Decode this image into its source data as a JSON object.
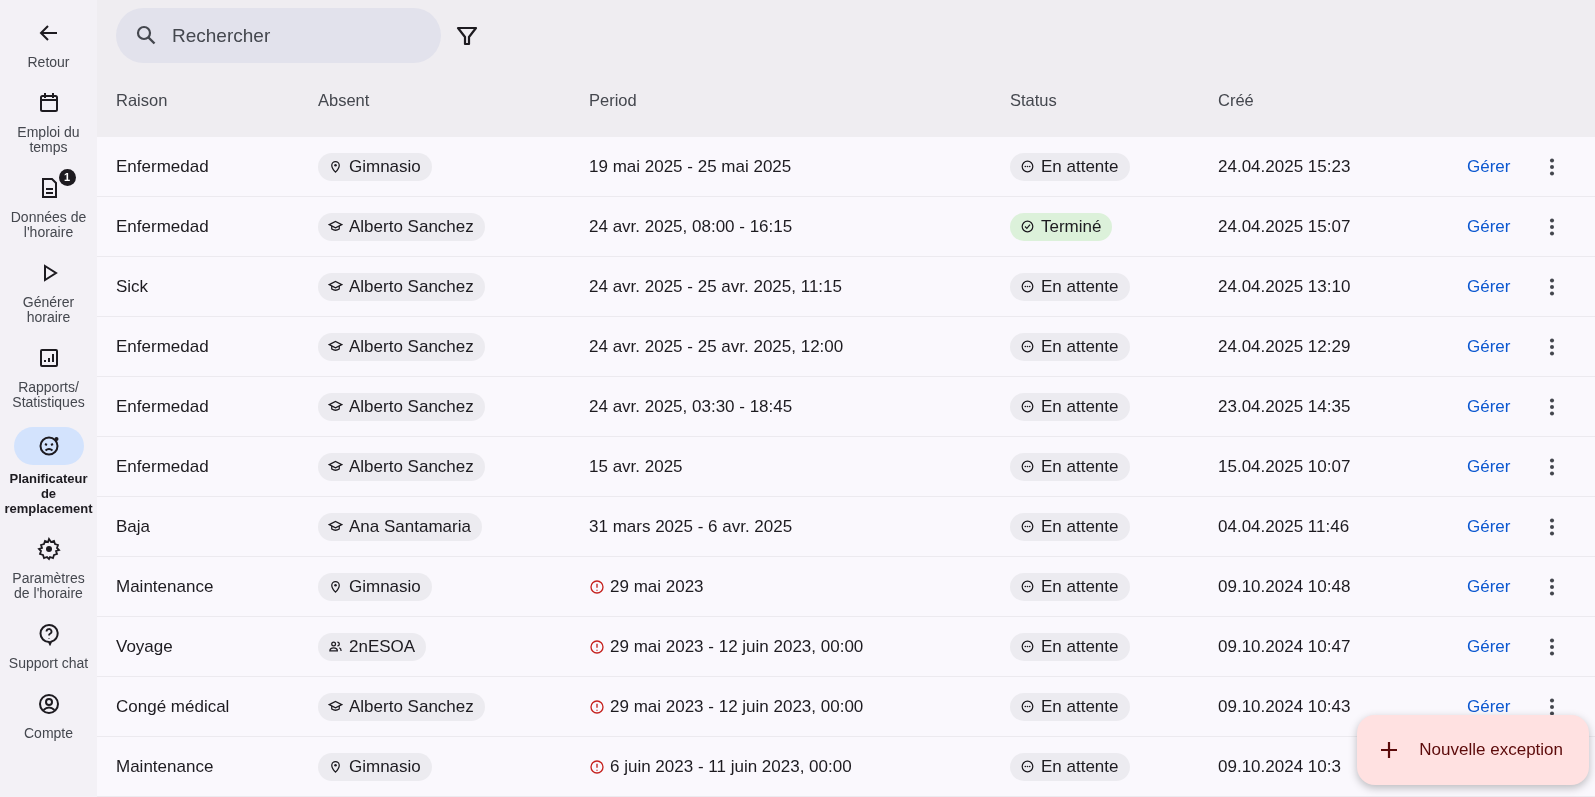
{
  "sidebar": {
    "items": [
      {
        "label": "Retour",
        "selected": false
      },
      {
        "label": "Emploi du temps",
        "selected": false
      },
      {
        "label": "Données de l'horaire",
        "selected": false,
        "badge": "1"
      },
      {
        "label": "Générer horaire",
        "selected": false
      },
      {
        "label": "Rapports/ Statistiques",
        "selected": false
      },
      {
        "label": "Planificateur de remplacement",
        "selected": true
      },
      {
        "label": "Paramètres de l'horaire",
        "selected": false
      },
      {
        "label": "Support chat",
        "selected": false
      },
      {
        "label": "Compte",
        "selected": false
      }
    ]
  },
  "search": {
    "placeholder": "Rechercher"
  },
  "table": {
    "columns": [
      "Raison",
      "Absent",
      "Period",
      "Status",
      "Créé"
    ],
    "rows": [
      {
        "reason": "Enfermedad",
        "absent": {
          "kind": "place",
          "label": "Gimnasio"
        },
        "period": {
          "warning": false,
          "text": "19 mai 2025 - 25 mai 2025"
        },
        "status": {
          "kind": "pending",
          "label": "En attente"
        },
        "created": "24.04.2025 15:23",
        "action": "Gérer"
      },
      {
        "reason": "Enfermedad",
        "absent": {
          "kind": "person",
          "label": "Alberto Sanchez"
        },
        "period": {
          "warning": false,
          "text": "24 avr. 2025, 08:00 - 16:15"
        },
        "status": {
          "kind": "done",
          "label": "Terminé"
        },
        "created": "24.04.2025 15:07",
        "action": "Gérer"
      },
      {
        "reason": "Sick",
        "absent": {
          "kind": "person",
          "label": "Alberto Sanchez"
        },
        "period": {
          "warning": false,
          "text": "24 avr. 2025 - 25 avr. 2025, 11:15"
        },
        "status": {
          "kind": "pending",
          "label": "En attente"
        },
        "created": "24.04.2025 13:10",
        "action": "Gérer"
      },
      {
        "reason": "Enfermedad",
        "absent": {
          "kind": "person",
          "label": "Alberto Sanchez"
        },
        "period": {
          "warning": false,
          "text": "24 avr. 2025 - 25 avr. 2025, 12:00"
        },
        "status": {
          "kind": "pending",
          "label": "En attente"
        },
        "created": "24.04.2025 12:29",
        "action": "Gérer"
      },
      {
        "reason": "Enfermedad",
        "absent": {
          "kind": "person",
          "label": "Alberto Sanchez"
        },
        "period": {
          "warning": false,
          "text": "24 avr. 2025, 03:30 - 18:45"
        },
        "status": {
          "kind": "pending",
          "label": "En attente"
        },
        "created": "23.04.2025 14:35",
        "action": "Gérer"
      },
      {
        "reason": "Enfermedad",
        "absent": {
          "kind": "person",
          "label": "Alberto Sanchez"
        },
        "period": {
          "warning": false,
          "text": "15 avr. 2025"
        },
        "status": {
          "kind": "pending",
          "label": "En attente"
        },
        "created": "15.04.2025 10:07",
        "action": "Gérer"
      },
      {
        "reason": "Baja",
        "absent": {
          "kind": "person",
          "label": "Ana Santamaria"
        },
        "period": {
          "warning": false,
          "text": "31 mars 2025 - 6 avr. 2025"
        },
        "status": {
          "kind": "pending",
          "label": "En attente"
        },
        "created": "04.04.2025 11:46",
        "action": "Gérer"
      },
      {
        "reason": "Maintenance",
        "absent": {
          "kind": "place",
          "label": "Gimnasio"
        },
        "period": {
          "warning": true,
          "text": "29 mai 2023"
        },
        "status": {
          "kind": "pending",
          "label": "En attente"
        },
        "created": "09.10.2024 10:48",
        "action": "Gérer"
      },
      {
        "reason": "Voyage",
        "absent": {
          "kind": "group",
          "label": "2nESOA"
        },
        "period": {
          "warning": true,
          "text": "29 mai 2023 - 12 juin 2023, 00:00"
        },
        "status": {
          "kind": "pending",
          "label": "En attente"
        },
        "created": "09.10.2024 10:47",
        "action": "Gérer"
      },
      {
        "reason": "Congé médical",
        "absent": {
          "kind": "person",
          "label": "Alberto Sanchez"
        },
        "period": {
          "warning": true,
          "text": "29 mai 2023 - 12 juin 2023, 00:00"
        },
        "status": {
          "kind": "pending",
          "label": "En attente"
        },
        "created": "09.10.2024 10:43",
        "action": "Gérer"
      },
      {
        "reason": "Maintenance",
        "absent": {
          "kind": "place",
          "label": "Gimnasio"
        },
        "period": {
          "warning": true,
          "text": "6 juin 2023 - 11 juin 2023, 00:00"
        },
        "status": {
          "kind": "pending",
          "label": "En attente"
        },
        "created": "09.10.2024 10:3"
      }
    ]
  },
  "fab": {
    "label": "Nouvelle exception"
  }
}
